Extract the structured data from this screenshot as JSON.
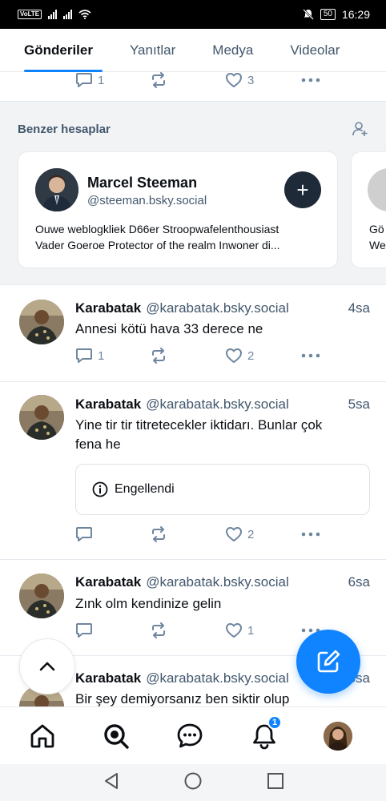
{
  "status_bar": {
    "volte": "VoLTE",
    "time": "16:29",
    "battery": "50"
  },
  "tabs": [
    {
      "label": "Gönderiler",
      "active": true
    },
    {
      "label": "Yanıtlar",
      "active": false
    },
    {
      "label": "Medya",
      "active": false
    },
    {
      "label": "Videolar",
      "active": false
    }
  ],
  "partial_post": {
    "reply_count": "1",
    "like_count": "3"
  },
  "suggested": {
    "title": "Benzer hesaplar",
    "card": {
      "name": "Marcel Steeman",
      "handle": "@steeman.bsky.social",
      "bio_line1": "Ouwe weblogkliek D66er Stroopwafelenthousiast",
      "bio_line2": "Vader Goeroe Protector of the realm Inwoner di...",
      "follow_label": "+"
    },
    "card2": {
      "bio_line1": "Gö",
      "bio_line2": "We"
    }
  },
  "posts": [
    {
      "name": "Karabatak",
      "handle": "@karabatak.bsky.social",
      "time": "4sa",
      "text": "Annesi kötü hava 33 derece ne",
      "reply_count": "1",
      "like_count": "2"
    },
    {
      "name": "Karabatak",
      "handle": "@karabatak.bsky.social",
      "time": "5sa",
      "text_line1": "Yine tir tir titretecekler iktidarı. Bunlar çok",
      "text_line2": "fena he",
      "embed_label": "Engellendi",
      "reply_count": "",
      "like_count": "2"
    },
    {
      "name": "Karabatak",
      "handle": "@karabatak.bsky.social",
      "time": "6sa",
      "text": "Zınk olm kendinize gelin",
      "reply_count": "",
      "like_count": "1"
    },
    {
      "name": "Karabatak",
      "handle": "@karabatak.bsky.social",
      "time": "6sa",
      "text": "Bir şey demiyorsanız ben siktir olup"
    }
  ],
  "bottom_nav": {
    "notification_badge": "1"
  },
  "colors": {
    "accent": "#1083fe",
    "muted": "#42576c",
    "icon": "#6f869f"
  }
}
